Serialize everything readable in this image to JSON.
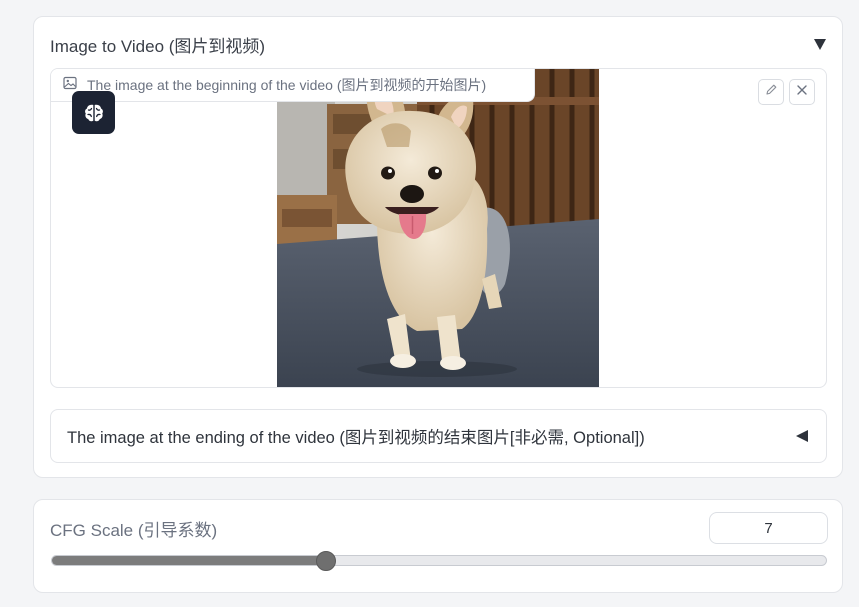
{
  "image_to_video": {
    "title": "Image to Video (图片到视频)",
    "start_image": {
      "label": "The image at the beginning of the video (图片到视频的开始图片)"
    },
    "end_image": {
      "label": "The image at the ending of the video (图片到视频的结束图片[非必需, Optional])"
    }
  },
  "cfg_scale": {
    "label": "CFG Scale (引导系数)",
    "value": "7",
    "slider_fraction": 0.354
  },
  "icons": {
    "collapse": "triangle-down-icon",
    "expand": "triangle-left-icon",
    "image": "image-icon",
    "badge": "brain-icon",
    "edit": "pencil-icon",
    "clear": "close-icon"
  },
  "colors": {
    "badge_bg": "#1c2333",
    "slider_fill": "#7c7c7c"
  }
}
